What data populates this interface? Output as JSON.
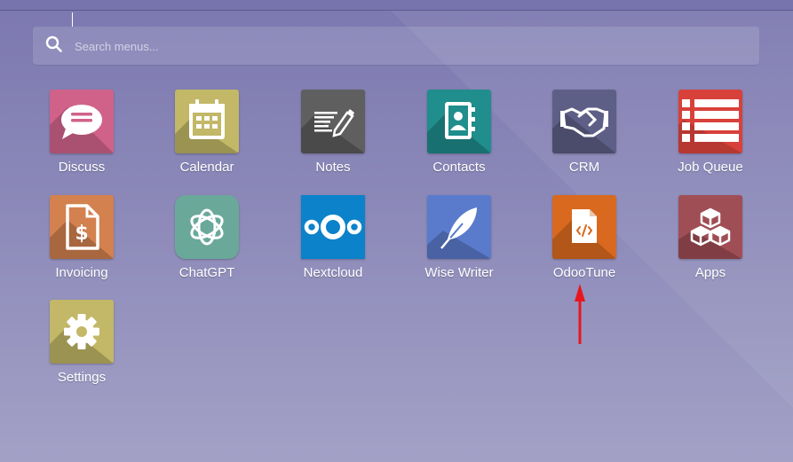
{
  "search": {
    "placeholder": "Search menus..."
  },
  "apps": [
    {
      "label": "Discuss",
      "icon": "chat-bubble-icon",
      "color": "#d0628a"
    },
    {
      "label": "Calendar",
      "icon": "calendar-icon",
      "color": "#c2b867"
    },
    {
      "label": "Notes",
      "icon": "notes-pen-icon",
      "color": "#5f5f5f"
    },
    {
      "label": "Contacts",
      "icon": "address-book-icon",
      "color": "#1f8e8c"
    },
    {
      "label": "CRM",
      "icon": "handshake-icon",
      "color": "#5e5f86"
    },
    {
      "label": "Job Queue",
      "icon": "list-icon",
      "color": "#d8413a"
    },
    {
      "label": "Invoicing",
      "icon": "invoice-dollar-icon",
      "color": "#d3814f"
    },
    {
      "label": "ChatGPT",
      "icon": "openai-logo-icon",
      "color": "#6aa89a"
    },
    {
      "label": "Nextcloud",
      "icon": "nextcloud-logo-icon",
      "color": "#0b82c9"
    },
    {
      "label": "Wise Writer",
      "icon": "feather-icon",
      "color": "#5a7bcc"
    },
    {
      "label": "OdooTune",
      "icon": "code-file-icon",
      "color": "#d9691f"
    },
    {
      "label": "Apps",
      "icon": "cubes-icon",
      "color": "#a04e55"
    },
    {
      "label": "Settings",
      "icon": "gear-icon",
      "color": "#c2b867"
    }
  ],
  "annotation": {
    "icon": "red-arrow-icon",
    "color": "#e8161e"
  }
}
